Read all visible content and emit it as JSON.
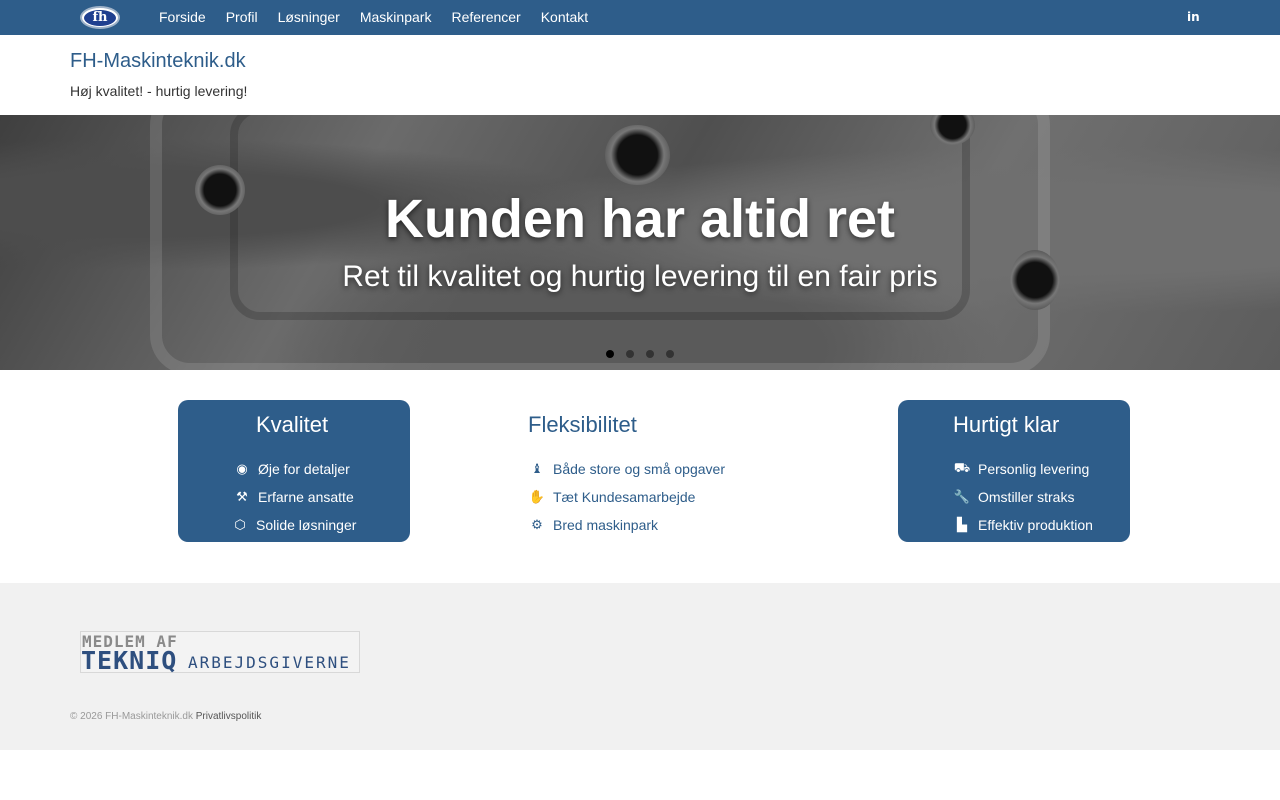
{
  "nav": {
    "logo_text": "fh",
    "items": [
      {
        "label": "Forside"
      },
      {
        "label": "Profil"
      },
      {
        "label": "Løsninger"
      },
      {
        "label": "Maskinpark"
      },
      {
        "label": "Referencer"
      },
      {
        "label": "Kontakt"
      }
    ],
    "social_icon": "linkedin-icon",
    "social_glyph": "in"
  },
  "header": {
    "site_title": "FH-Maskinteknik.dk",
    "tagline": "Høj kvalitet! - hurtig levering!"
  },
  "hero": {
    "title": "Kunden har altid ret",
    "subtitle": "Ret til kvalitet og hurtig levering til en fair pris",
    "slides_count": 4,
    "active_slide": 1
  },
  "features": [
    {
      "title": "Kvalitet",
      "style": "filled",
      "items": [
        {
          "icon": "eye-icon",
          "glyph": "◉",
          "label": "Øje for detaljer"
        },
        {
          "icon": "people-carry-icon",
          "glyph": "⚒",
          "label": "Erfarne ansatte"
        },
        {
          "icon": "cube-icon",
          "glyph": "⬡",
          "label": "Solide løsninger"
        }
      ]
    },
    {
      "title": "Fleksibilitet",
      "style": "plain",
      "items": [
        {
          "icon": "chess-icon",
          "glyph": "♝",
          "label": "Både store og små opgaver"
        },
        {
          "icon": "handshake-icon",
          "glyph": "✋",
          "label": "Tæt Kundesamarbejde"
        },
        {
          "icon": "cogs-icon",
          "glyph": "⚙",
          "label": "Bred maskinpark"
        }
      ]
    },
    {
      "title": "Hurtigt klar",
      "style": "filled",
      "items": [
        {
          "icon": "truck-icon",
          "glyph": "⛟",
          "label": "Personlig levering"
        },
        {
          "icon": "wrench-icon",
          "glyph": "🔧",
          "label": "Omstiller straks"
        },
        {
          "icon": "industry-icon",
          "glyph": "▙",
          "label": "Effektiv produktion"
        }
      ]
    }
  ],
  "footer": {
    "member_top": "MEDLEM AF",
    "member_brand": "TEKNIQ",
    "member_suffix": "ARBEJDSGIVERNE",
    "copyright": "© 2026 FH-Maskinteknik.dk",
    "privacy_link": "Privatlivspolitik"
  },
  "colors": {
    "brand_blue": "#2e5d8a",
    "footer_bg": "#f1f1f1"
  }
}
